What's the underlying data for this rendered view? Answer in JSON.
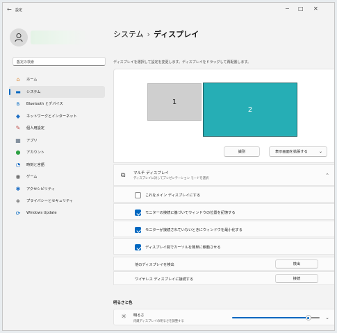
{
  "window": {
    "app_title": "設定",
    "back_icon": "back-arrow-icon",
    "controls": [
      "minimize-icon",
      "maximize-icon",
      "close-icon"
    ]
  },
  "sidebar": {
    "search_placeholder": "設定の検索",
    "items": [
      {
        "label": "ホーム",
        "icon": "home-icon",
        "color": "#d9822b",
        "active": false
      },
      {
        "label": "システム",
        "icon": "system-icon",
        "color": "#0067c0",
        "active": true
      },
      {
        "label": "Bluetooth とデバイス",
        "icon": "bluetooth-icon",
        "color": "#0067c0",
        "active": false
      },
      {
        "label": "ネットワークとインターネット",
        "icon": "network-icon",
        "color": "#1f6fc5",
        "active": false
      },
      {
        "label": "個人用設定",
        "icon": "personalization-icon",
        "color": "#c0504d",
        "active": false
      },
      {
        "label": "アプリ",
        "icon": "apps-icon",
        "color": "#5a6b7d",
        "active": false
      },
      {
        "label": "アカウント",
        "icon": "accounts-icon",
        "color": "#2ea043",
        "active": false
      },
      {
        "label": "時刻と言語",
        "icon": "time-language-icon",
        "color": "#1f6fc5",
        "active": false
      },
      {
        "label": "ゲーム",
        "icon": "gaming-icon",
        "color": "#6b6b6b",
        "active": false
      },
      {
        "label": "アクセシビリティ",
        "icon": "accessibility-icon",
        "color": "#1f6fc5",
        "active": false
      },
      {
        "label": "プライバシーとセキュリティ",
        "icon": "privacy-shield-icon",
        "color": "#7a7a7a",
        "active": false
      },
      {
        "label": "Windows Update",
        "icon": "windows-update-icon",
        "color": "#0067c0",
        "active": false
      }
    ]
  },
  "main": {
    "breadcrumb_parent": "システム",
    "breadcrumb_sep": "›",
    "breadcrumb_current": "ディスプレイ",
    "hint": "ディスプレイを選択して設定を変更します。ディスプレイをドラッグして再配置します。",
    "monitors": [
      {
        "label": "1"
      },
      {
        "label": "2",
        "selected": true
      }
    ],
    "identify_label": "識別",
    "extend_label": "表示画面を拡張する",
    "multi_display": {
      "title": "マルチ ディスプレイ",
      "subtitle": "ディスプレイに対してプレゼンテーション モードを選択",
      "options": [
        {
          "label": "これをメイン ディスプレイにする",
          "checked": false
        },
        {
          "label": "モニターの接続に基づいてウィンドウの位置を記憶する",
          "checked": true
        },
        {
          "label": "モニターが接続されていないときにウィンドウを最小化する",
          "checked": true
        },
        {
          "label": "ディスプレイ間でカーソルを簡単に移動させる",
          "checked": true
        }
      ],
      "detect": {
        "label": "他のディスプレイを検出",
        "button": "検出"
      },
      "wireless": {
        "label": "ワイヤレス ディスプレイに接続する",
        "button": "接続"
      }
    },
    "brightness_section": "明るさと色",
    "brightness": {
      "title": "明るさ",
      "subtitle": "内蔵ディスプレイの明るさを調整する",
      "level_percent": 87
    }
  }
}
